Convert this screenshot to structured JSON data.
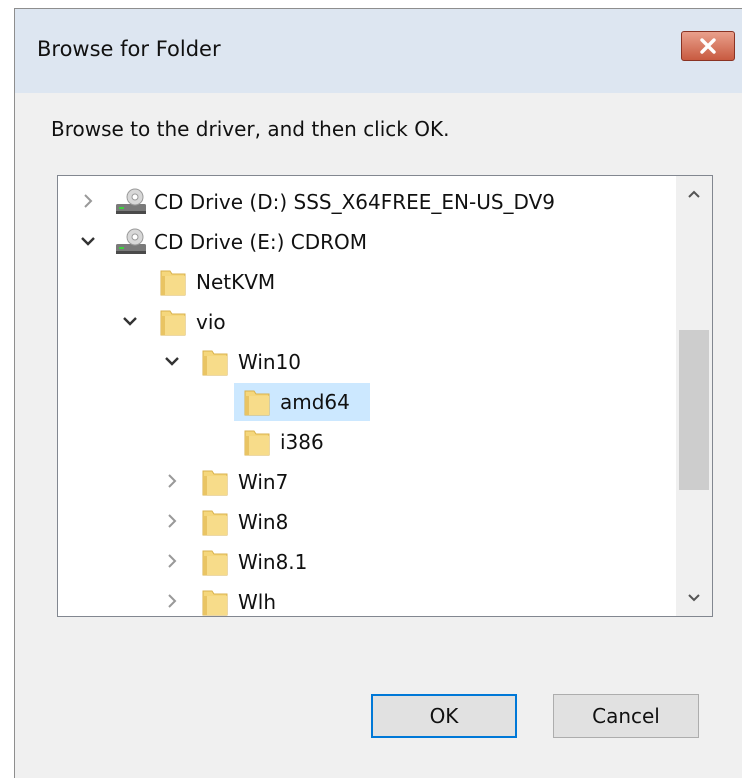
{
  "window": {
    "title": "Browse for Folder",
    "close_label": "X"
  },
  "instruction": "Browse to the driver, and then click OK.",
  "tree": {
    "items": [
      {
        "label": "CD Drive (D:) SSS_X64FREE_EN-US_DV9",
        "type": "drive",
        "state": "collapsed",
        "level": 0
      },
      {
        "label": "CD Drive (E:) CDROM",
        "type": "drive",
        "state": "expanded",
        "level": 0
      },
      {
        "label": "NetKVM",
        "type": "folder",
        "state": "none",
        "level": 1
      },
      {
        "label": "vio",
        "type": "folder",
        "state": "expanded",
        "level": 1
      },
      {
        "label": "Win10",
        "type": "folder",
        "state": "expanded",
        "level": 2
      },
      {
        "label": "amd64",
        "type": "folder",
        "state": "none",
        "level": 3,
        "selected": true
      },
      {
        "label": "i386",
        "type": "folder",
        "state": "none",
        "level": 3
      },
      {
        "label": "Win7",
        "type": "folder",
        "state": "collapsed",
        "level": 2
      },
      {
        "label": "Win8",
        "type": "folder",
        "state": "collapsed",
        "level": 2
      },
      {
        "label": "Win8.1",
        "type": "folder",
        "state": "collapsed",
        "level": 2
      },
      {
        "label": "Wlh",
        "type": "folder",
        "state": "collapsed",
        "level": 2
      }
    ]
  },
  "buttons": {
    "ok": "OK",
    "cancel": "Cancel"
  },
  "colors": {
    "selection": "#cce8ff",
    "folder": "#f5d77c",
    "default_button_border": "#0078d7"
  }
}
